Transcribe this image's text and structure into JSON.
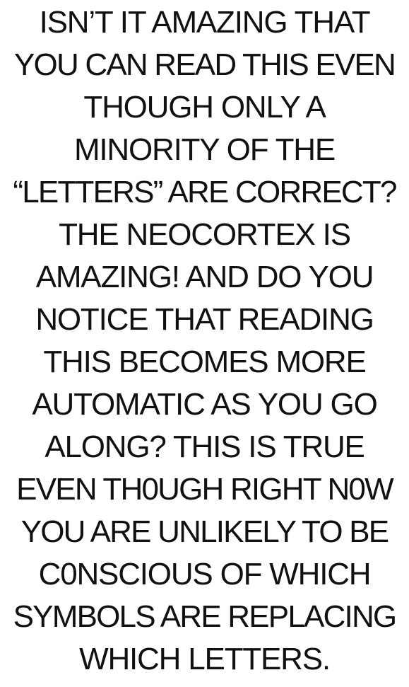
{
  "lines": [
    "ISN’T IT AMAZING THAT",
    "YOU CAN READ THIS EVEN",
    "THOUGH ONLY A",
    "MINORITY OF THE",
    "“LETTERS” ARE CORRECT?",
    "THE NEOCORTEX IS",
    "AMAZING! AND DO YOU",
    "NOTICE THAT READING",
    "THIS BECOMES MORE",
    "AUTOMATIC AS YOU GO",
    "ALONG? THIS IS TRUE",
    "EVEN TH0UGH RIGHT N0W",
    "YOU ARE UNLIKELY TO BE",
    "C0NSCIOUS OF WHICH",
    "SYMBOLS ARE REPLACING",
    "WHICH LETTERS."
  ]
}
